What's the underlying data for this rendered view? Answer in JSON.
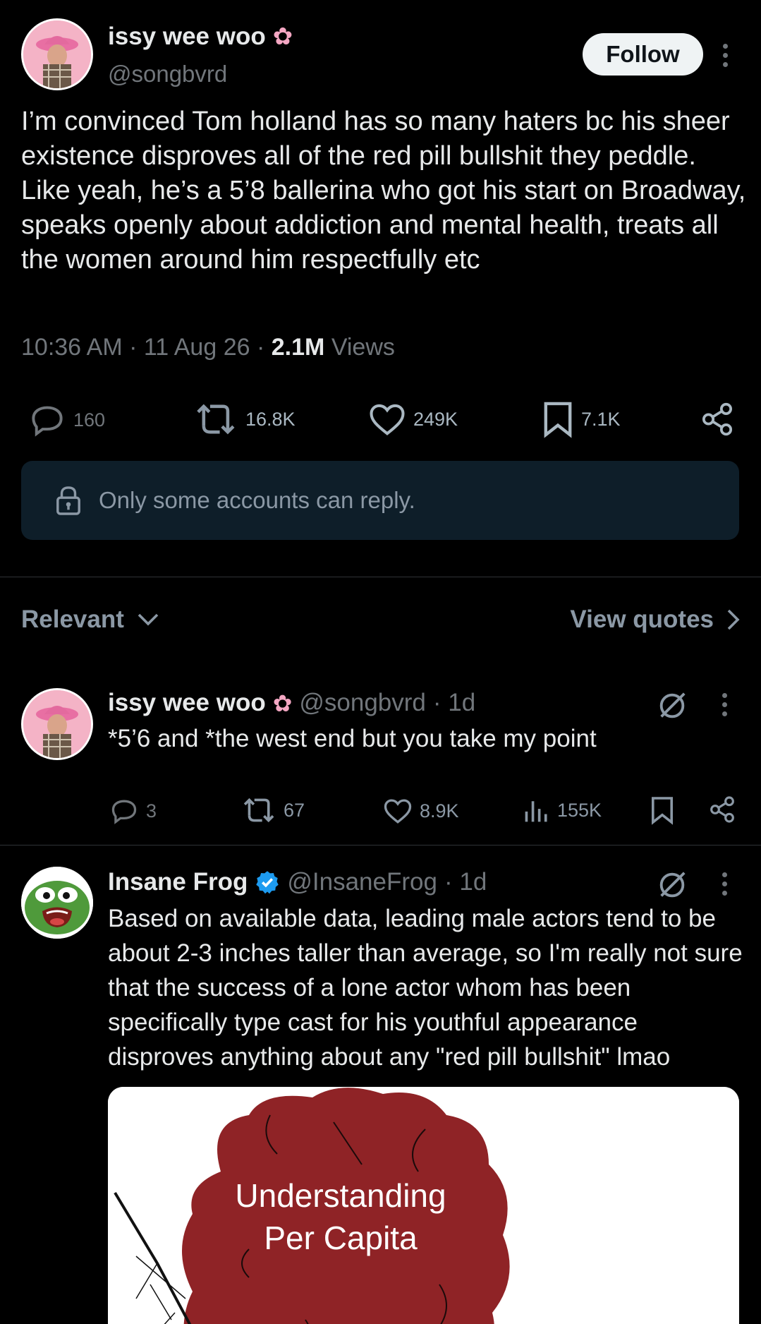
{
  "main_tweet": {
    "author_name": "issy wee woo",
    "handle": "@songbvrd",
    "follow_label": "Follow",
    "text": "I’m convinced Tom holland has so many haters bc his sheer existence disproves all of the red pill bullshit they peddle. Like yeah, he’s a 5’8 ballerina who got his start on Broadway, speaks openly about addiction and mental health, treats all the women around him respectfully etc",
    "time": "10:36 AM",
    "date": "11 Aug 26",
    "views_count": "2.1M",
    "views_label": "Views",
    "replies": "160",
    "reposts": "16.8K",
    "likes": "249K",
    "bookmarks": "7.1K",
    "reply_restriction": "Only some accounts can reply."
  },
  "filters": {
    "sort_label": "Relevant",
    "quotes_label": "View quotes"
  },
  "replies": [
    {
      "author_name": "issy wee woo",
      "handle": "@songbvrd",
      "age": "· 1d",
      "text": "*5’6 and *the west end but you take my point",
      "replies": "3",
      "reposts": "67",
      "likes": "8.9K",
      "views": "155K"
    },
    {
      "author_name": "Insane Frog",
      "handle": "@InsaneFrog",
      "age": "· 1d",
      "verified": true,
      "text": "Based on available data, leading male actors tend to be about 2-3 inches taller than average, so I'm really not sure that the success of a lone actor whom has been specifically type cast for his youthful appearance disproves anything about any \"red pill bullshit\" lmao",
      "image_caption_line1": "Understanding",
      "image_caption_line2": "Per Capita"
    }
  ],
  "colors": {
    "background": "#000000",
    "text": "#e7e9ea",
    "muted": "#71767b",
    "reply_box": "#0e1e29",
    "verified": "#1d9bf0",
    "blob": "#8f2326"
  }
}
